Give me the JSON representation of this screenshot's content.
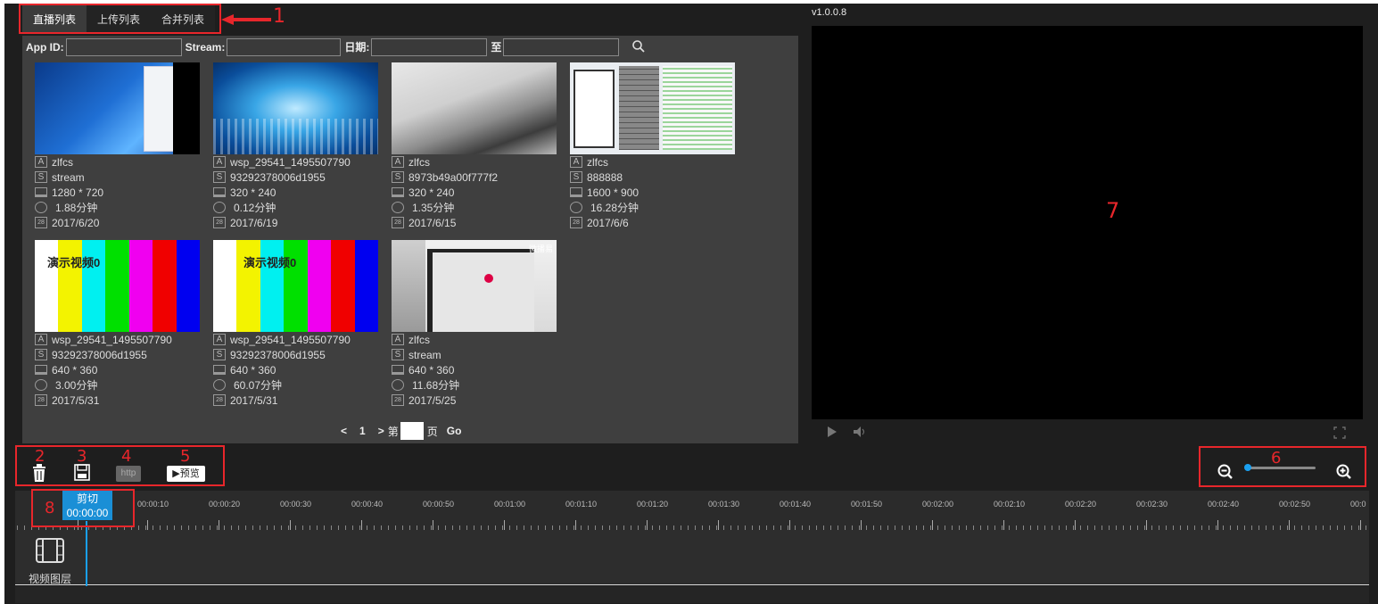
{
  "tabs": [
    "直播列表",
    "上传列表",
    "合并列表"
  ],
  "active_tab": 0,
  "filter": {
    "appid_label": "App ID:",
    "stream_label": "Stream:",
    "date_label": "日期:",
    "to_label": "至",
    "appid_value": "",
    "stream_value": "",
    "date_from": "",
    "date_to": ""
  },
  "cards": [
    {
      "thumb": "desktop",
      "app": "zlfcs",
      "stream": "stream",
      "resolution": "1280 * 720",
      "duration": "1.88分钟",
      "date": "2017/6/20"
    },
    {
      "thumb": "wave",
      "app": "wsp_29541_1495507790",
      "stream": "93292378006d1955",
      "resolution": "320 * 240",
      "duration": "0.12分钟",
      "date": "2017/6/19"
    },
    {
      "thumb": "office",
      "app": "zlfcs",
      "stream": "8973b49a00f777f2",
      "resolution": "320 * 240",
      "duration": "1.35分钟",
      "date": "2017/6/15"
    },
    {
      "thumb": "screen",
      "app": "zlfcs",
      "stream": "888888",
      "resolution": "1600 * 900",
      "duration": "16.28分钟",
      "date": "2017/6/6"
    },
    {
      "thumb": "bars",
      "overlay": "演示视频0",
      "app": "wsp_29541_1495507790",
      "stream": "93292378006d1955",
      "resolution": "640 * 360",
      "duration": "3.00分钟",
      "date": "2017/5/31"
    },
    {
      "thumb": "bars",
      "overlay": "演示视频0",
      "app": "wsp_29541_1495507790",
      "stream": "93292378006d1955",
      "resolution": "640 * 360",
      "duration": "60.07分钟",
      "date": "2017/5/31"
    },
    {
      "thumb": "room",
      "overlay": "微播易",
      "app": "zlfcs",
      "stream": "stream",
      "resolution": "640 * 360",
      "duration": "11.68分钟",
      "date": "2017/5/25"
    }
  ],
  "meta_icons": {
    "app": "A",
    "stream": "S",
    "date": "28"
  },
  "pager": {
    "prev": "<",
    "current": "1",
    "next": ">",
    "page_prefix": "第",
    "page_suffix": "页",
    "go": "Go",
    "page_input": ""
  },
  "version": "v1.0.0.8",
  "toolbar": {
    "http_label": "http",
    "preview_label": "预览"
  },
  "timeline": {
    "cut_label": "剪切",
    "cut_time": "00:00:00",
    "ticks": [
      "00:00:10",
      "00:00:20",
      "00:00:30",
      "00:00:40",
      "00:00:50",
      "00:01:00",
      "00:01:10",
      "00:01:20",
      "00:01:30",
      "00:01:40",
      "00:01:50",
      "00:02:00",
      "00:02:10",
      "00:02:20",
      "00:02:30",
      "00:02:40",
      "00:02:50",
      "00:0"
    ],
    "layer_label": "视频图层"
  },
  "annotations": [
    "1",
    "2",
    "3",
    "4",
    "5",
    "6",
    "7",
    "8"
  ],
  "colors": {
    "annotation": "#e8262b",
    "accent": "#1a8fd6",
    "panel": "#3f3f3f",
    "background": "#1e1e1e"
  }
}
